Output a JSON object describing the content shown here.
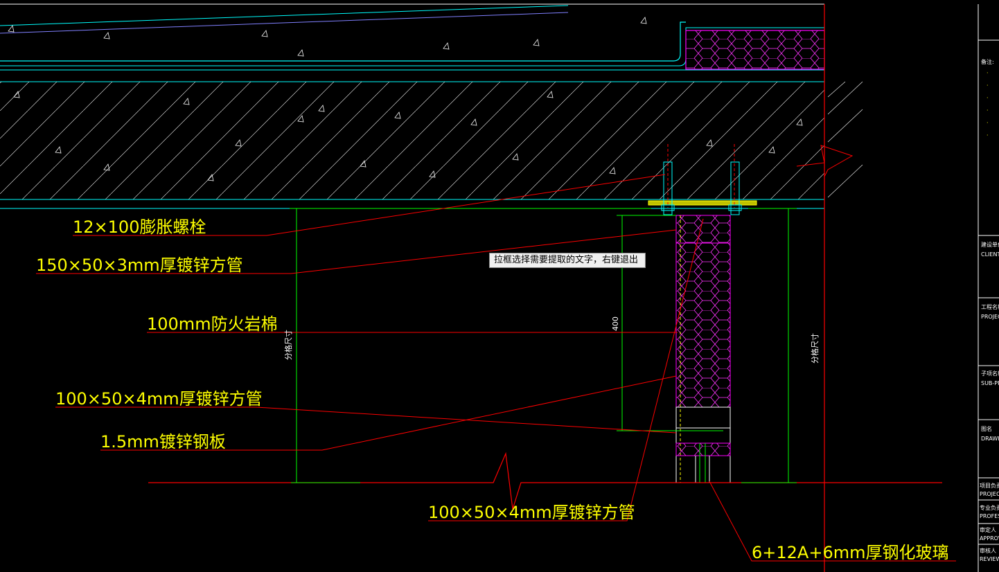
{
  "labels": {
    "bolt": "12×100膨胀螺栓",
    "tube_150": "150×50×3mm厚镀锌方管",
    "rockwool": "100mm防火岩棉",
    "tube_100_a": "100×50×4mm厚镀锌方管",
    "steel_plate": "1.5mm镀锌钢板",
    "tube_100_b": "100×50×4mm厚镀锌方管",
    "glass": "6+12A+6mm厚钢化玻璃"
  },
  "dimensions": {
    "left_height": "分格尺寸",
    "mid_height": "400",
    "right_height": "分格尺寸"
  },
  "tooltip": "拉框选择需要提取的文字，右键退出",
  "title_block": {
    "notes": "备注:",
    "client_cn": "建设单位:",
    "client_en": "CLIENT",
    "project_cn": "工程名称:",
    "project_en": "PROJECT N",
    "sub_cn": "子项名称:",
    "sub_en": "SUB-PROJ",
    "drawing_cn": "图名",
    "drawing_en": "DRAWING",
    "dept_cn": "项目负责人",
    "dept_en": "PROJECT DIR",
    "prof_cn": "专业负责人",
    "prof_en": "PROFESSIONAL",
    "approve_cn": "审定人",
    "approve_en": "APPROVED",
    "review_cn": "审核人",
    "review_en": "REVIEW BY"
  },
  "colors": {
    "background": "#000000",
    "cyan": "#00ffff",
    "yellow": "#ffff00",
    "red": "#ff0000",
    "green": "#00ff00",
    "magenta": "#ff00ff",
    "white": "#ffffff"
  }
}
